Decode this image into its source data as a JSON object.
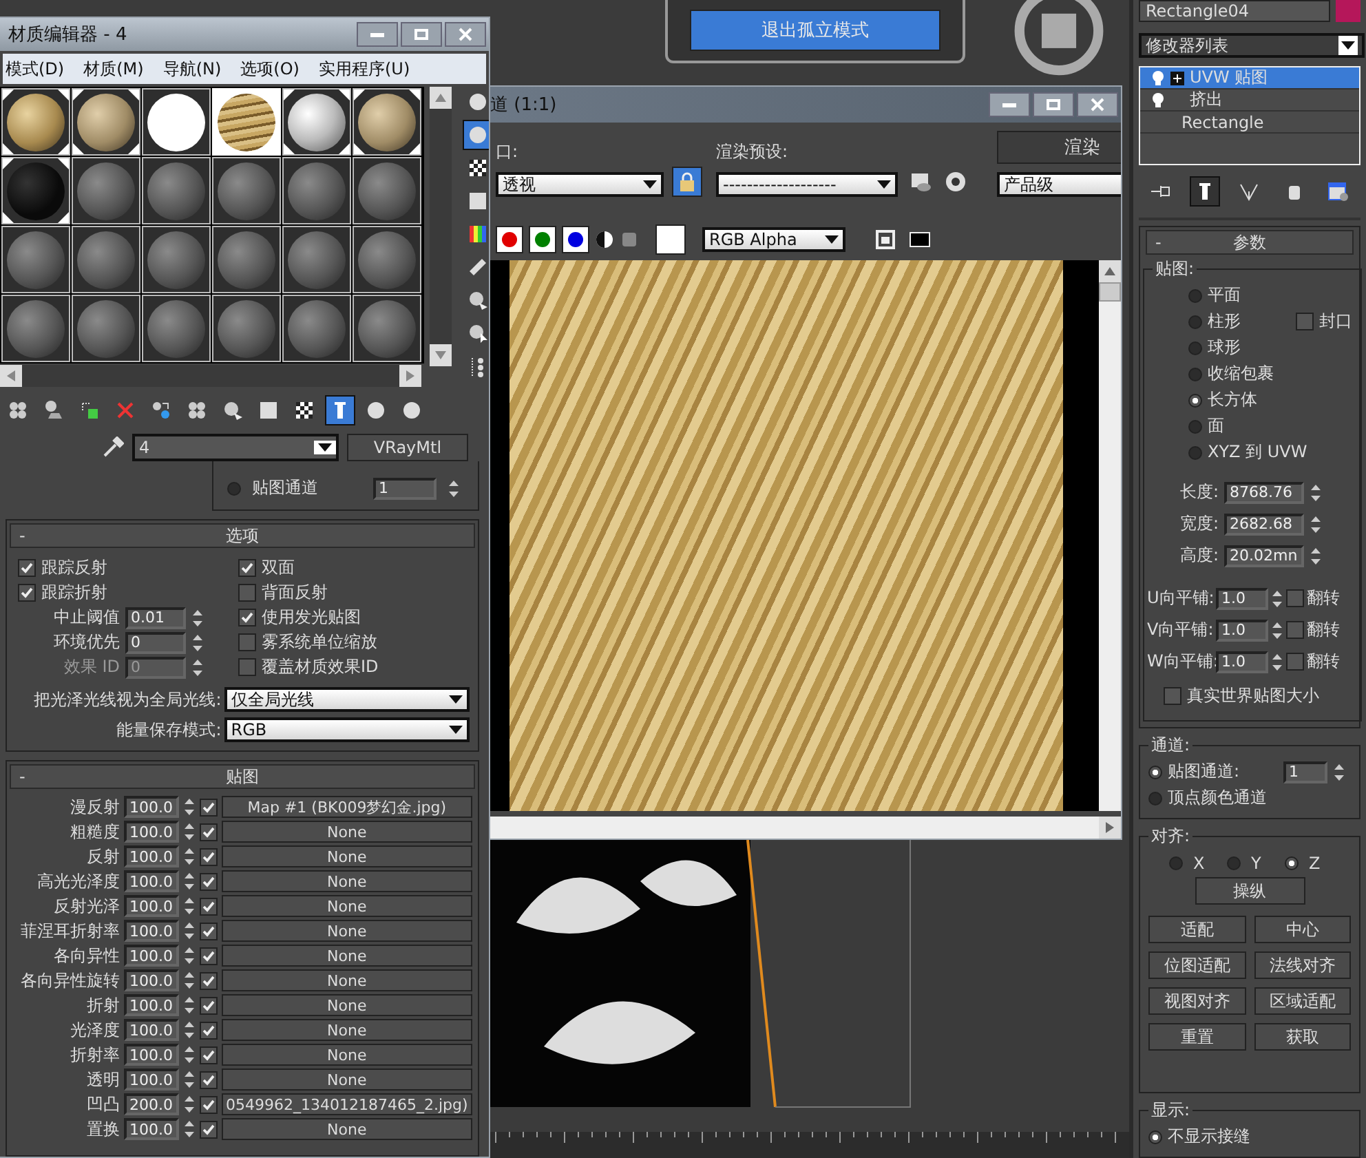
{
  "isolate_button": "退出孤立模式",
  "material_editor": {
    "title": "材质编辑器 - 4",
    "menu": [
      "模式(D)",
      "材质(M)",
      "导航(N)",
      "选项(O)",
      "实用程序(U)"
    ],
    "slots": [
      {
        "kind": "gold",
        "selected": false,
        "in_scene": true
      },
      {
        "kind": "beige",
        "selected": false,
        "in_scene": true
      },
      {
        "kind": "white",
        "selected": false,
        "in_scene": false
      },
      {
        "kind": "texture",
        "selected": true,
        "in_scene": true
      },
      {
        "kind": "silver",
        "selected": false,
        "in_scene": true
      },
      {
        "kind": "beige",
        "selected": false,
        "in_scene": true
      },
      {
        "kind": "black",
        "selected": false,
        "in_scene": true
      },
      {
        "kind": "gray",
        "selected": false,
        "in_scene": false
      },
      {
        "kind": "gray",
        "selected": false,
        "in_scene": false
      },
      {
        "kind": "gray",
        "selected": false,
        "in_scene": false
      },
      {
        "kind": "gray",
        "selected": false,
        "in_scene": false
      },
      {
        "kind": "gray",
        "selected": false,
        "in_scene": false
      },
      {
        "kind": "gray",
        "selected": false,
        "in_scene": false
      },
      {
        "kind": "gray",
        "selected": false,
        "in_scene": false
      },
      {
        "kind": "gray",
        "selected": false,
        "in_scene": false
      },
      {
        "kind": "gray",
        "selected": false,
        "in_scene": false
      },
      {
        "kind": "gray",
        "selected": false,
        "in_scene": false
      },
      {
        "kind": "gray",
        "selected": false,
        "in_scene": false
      },
      {
        "kind": "gray",
        "selected": false,
        "in_scene": false
      },
      {
        "kind": "gray",
        "selected": false,
        "in_scene": false
      },
      {
        "kind": "gray",
        "selected": false,
        "in_scene": false
      },
      {
        "kind": "gray",
        "selected": false,
        "in_scene": false
      },
      {
        "kind": "gray",
        "selected": false,
        "in_scene": false
      },
      {
        "kind": "gray",
        "selected": false,
        "in_scene": false
      }
    ],
    "side_tools": [
      {
        "kind": "sphere",
        "selected": false
      },
      {
        "kind": "sphere",
        "selected": true
      },
      {
        "kind": "checker",
        "selected": false
      },
      {
        "kind": "square",
        "selected": false
      },
      {
        "kind": "colorbars",
        "selected": false
      },
      {
        "kind": "ruler",
        "selected": false
      },
      {
        "kind": "sphere-arrow",
        "selected": false
      },
      {
        "kind": "sphere-cursor",
        "selected": false
      },
      {
        "kind": "dots",
        "selected": false
      }
    ],
    "bottom_tools": [
      {
        "kind": "spheres",
        "selected": false
      },
      {
        "kind": "sphere-plane",
        "selected": false
      },
      {
        "kind": "cube",
        "selected": false
      },
      {
        "kind": "cross",
        "selected": false
      },
      {
        "kind": "swap",
        "selected": false
      },
      {
        "kind": "spheres",
        "selected": false
      },
      {
        "kind": "sphere-arrow",
        "selected": false
      },
      {
        "kind": "square",
        "selected": false
      },
      {
        "kind": "checker",
        "selected": false
      },
      {
        "kind": "pillar",
        "selected": true
      },
      {
        "kind": "sphere",
        "selected": false
      },
      {
        "kind": "sphere",
        "selected": false
      }
    ],
    "material_name": "4",
    "material_type": "VRayMtl",
    "map_channel": {
      "label": "贴图通道",
      "value": "1",
      "selected": false
    },
    "options": {
      "toggle": "-",
      "title": "选项",
      "left_checks": [
        {
          "label": "跟踪反射",
          "checked": true
        },
        {
          "label": "跟踪折射",
          "checked": true
        }
      ],
      "spinners": [
        {
          "label": "中止阈值",
          "value": "0.01",
          "disabled": false
        },
        {
          "label": "环境优先",
          "value": "0",
          "disabled": false
        },
        {
          "label": "效果 ID",
          "value": "0",
          "disabled": true
        }
      ],
      "right_checks": [
        {
          "label": "双面",
          "checked": true
        },
        {
          "label": "背面反射",
          "checked": false
        },
        {
          "label": "使用发光贴图",
          "checked": true
        },
        {
          "label": "雾系统单位缩放",
          "checked": false
        },
        {
          "label": "覆盖材质效果ID",
          "checked": false
        }
      ],
      "gloss_rays": {
        "label": "把光泽光线视为全局光线:",
        "value": "仅全局光线"
      },
      "energy_mode": {
        "label": "能量保存模式:",
        "value": "RGB"
      }
    },
    "maps": {
      "toggle": "-",
      "title": "贴图",
      "rows": [
        {
          "label": "漫反射",
          "amount": "100.0",
          "enabled": true,
          "map": "Map #1 (BK009梦幻金.jpg)"
        },
        {
          "label": "粗糙度",
          "amount": "100.0",
          "enabled": true,
          "map": "None"
        },
        {
          "label": "反射",
          "amount": "100.0",
          "enabled": true,
          "map": "None"
        },
        {
          "label": "高光光泽度",
          "amount": "100.0",
          "enabled": true,
          "map": "None"
        },
        {
          "label": "反射光泽",
          "amount": "100.0",
          "enabled": true,
          "map": "None"
        },
        {
          "label": "菲涅耳折射率",
          "amount": "100.0",
          "enabled": true,
          "map": "None"
        },
        {
          "label": "各向异性",
          "amount": "100.0",
          "enabled": true,
          "map": "None"
        },
        {
          "label": "各向异性旋转",
          "amount": "100.0",
          "enabled": true,
          "map": "None"
        },
        {
          "label": "折射",
          "amount": "100.0",
          "enabled": true,
          "map": "None"
        },
        {
          "label": "光泽度",
          "amount": "100.0",
          "enabled": true,
          "map": "None"
        },
        {
          "label": "折射率",
          "amount": "100.0",
          "enabled": true,
          "map": "None"
        },
        {
          "label": "透明",
          "amount": "100.0",
          "enabled": true,
          "map": "None"
        },
        {
          "label": "凹凸",
          "amount": "200.0",
          "enabled": true,
          "map": "0549962_134012187465_2.jpg)"
        },
        {
          "label": "置换",
          "amount": "100.0",
          "enabled": true,
          "map": "None"
        }
      ]
    }
  },
  "render_window": {
    "title": "道 (1:1)",
    "viewport_label": "口:",
    "viewport_value": "透视",
    "lock": {
      "selected": true
    },
    "preset_label": "渲染预设:",
    "preset_value": "-------------------",
    "render_button": "渲染",
    "quality": "产品级",
    "channels": [
      {
        "color": "#e00000",
        "selected": true
      },
      {
        "color": "#008000",
        "selected": true
      },
      {
        "color": "#0000e0",
        "selected": true
      }
    ],
    "display_channel": "RGB Alpha"
  },
  "command_panel": {
    "object_name": "Rectangle04",
    "modifier_list": "修改器列表",
    "stack": [
      {
        "kind": "modifier",
        "label": "UVW 贴图",
        "selected": true,
        "expandable": true
      },
      {
        "kind": "modifier",
        "label": "挤出",
        "selected": false,
        "expandable": false
      },
      {
        "kind": "base",
        "label": "Rectangle",
        "selected": false,
        "expandable": false
      }
    ],
    "stack_tools": [
      {
        "kind": "pin",
        "selected": false
      },
      {
        "kind": "pillar",
        "selected": true
      },
      {
        "kind": "fork",
        "selected": false
      },
      {
        "kind": "cylinder",
        "selected": false
      },
      {
        "kind": "config",
        "selected": false
      }
    ],
    "params": {
      "toggle": "-",
      "title": "参数",
      "mapping_label": "贴图:",
      "types": [
        {
          "label": "平面",
          "selected": false
        },
        {
          "label": "柱形",
          "selected": false
        },
        {
          "label": "球形",
          "selected": false
        },
        {
          "label": "收缩包裹",
          "selected": false
        },
        {
          "label": "长方体",
          "selected": true
        },
        {
          "label": "面",
          "selected": false
        },
        {
          "label": "XYZ 到 UVW",
          "selected": false
        }
      ],
      "cap": {
        "label": "封口",
        "checked": false
      },
      "sizes": [
        {
          "label": "长度:",
          "value": "8768.76"
        },
        {
          "label": "宽度:",
          "value": "2682.68"
        },
        {
          "label": "高度:",
          "value": "20.02mn"
        }
      ],
      "tiles": [
        {
          "label": "U向平铺:",
          "value": "1.0",
          "flip_label": "翻转",
          "flip": false
        },
        {
          "label": "V向平铺:",
          "value": "1.0",
          "flip_label": "翻转",
          "flip": false
        },
        {
          "label": "W向平铺:",
          "value": "1.0",
          "flip_label": "翻转",
          "flip": false
        }
      ],
      "real_world": {
        "label": "真实世界贴图大小",
        "checked": false
      }
    },
    "channel": {
      "label": "通道:",
      "options": [
        {
          "label": "贴图通道:",
          "selected": true
        },
        {
          "label": "顶点颜色通道",
          "selected": false
        }
      ],
      "value": "1"
    },
    "alignment": {
      "label": "对齐:",
      "axes": [
        {
          "label": "X",
          "selected": false
        },
        {
          "label": "Y",
          "selected": false
        },
        {
          "label": "Z",
          "selected": true
        }
      ],
      "manipulate": "操纵",
      "buttons": [
        "适配",
        "中心",
        "位图适配",
        "法线对齐",
        "视图对齐",
        "区域适配",
        "重置",
        "获取"
      ]
    },
    "display": {
      "label": "显示:",
      "options": [
        {
          "label": "不显示接缝",
          "selected": true
        }
      ]
    }
  }
}
